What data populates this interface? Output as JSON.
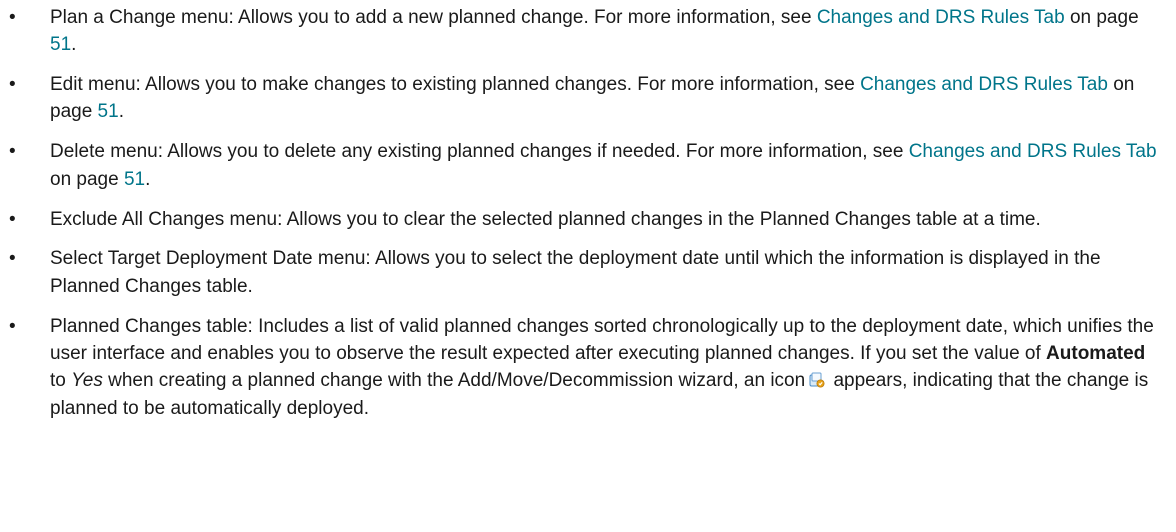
{
  "items": [
    {
      "lead": "Plan a Change menu: Allows you to add a new planned change. For more information, see ",
      "link": "Changes and DRS Rules Tab",
      "mid": " on page ",
      "page": "51",
      "tail": "."
    },
    {
      "lead": "Edit menu: Allows you to make changes to existing planned changes. For more information, see ",
      "link": "Changes and DRS Rules Tab",
      "mid": " on page ",
      "page": "51",
      "tail": "."
    },
    {
      "lead": "Delete menu: Allows you to delete any existing planned changes if needed. For more information, see ",
      "link": "Changes and DRS Rules Tab",
      "mid": " on page ",
      "page": "51",
      "tail": "."
    },
    {
      "text": "Exclude All Changes menu: Allows you to clear the selected planned changes in the Planned Changes table at a time."
    },
    {
      "text": "Select Target Deployment Date menu: Allows you to select the deployment date until which the information is displayed in the Planned Changes table."
    },
    {
      "p1": "Planned Changes table: Includes a list of valid planned changes sorted chronologically up to the deployment date, which unifies the user interface and enables you to observe the result expected after executing planned changes. If you set the value of ",
      "bold": "Automated",
      "p2": " to ",
      "italic": "Yes",
      "p3": " when creating a planned change with the Add/Move/Decommission wizard, an icon",
      "p4": " appears, indicating that the change is planned to be automatically deployed."
    }
  ],
  "icons": {
    "automated": "automated-deploy-icon"
  },
  "colors": {
    "link": "#00758a",
    "text": "#1a1a1a"
  }
}
